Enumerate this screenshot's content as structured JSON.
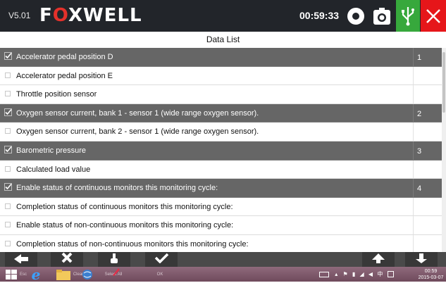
{
  "header": {
    "version": "V5.01",
    "brand_prefix": "F",
    "brand_o": "O",
    "brand_suffix": "XWELL",
    "time": "00:59:33",
    "colors": {
      "bar": "#22252a",
      "usb": "#37a83c",
      "close": "#e6161a",
      "logo_accent": "#e4312b"
    }
  },
  "page_title": "Data List",
  "rows": [
    {
      "label": "Accelerator pedal position D",
      "checked": true,
      "index": "1"
    },
    {
      "label": "Accelerator pedal position E",
      "checked": false,
      "index": ""
    },
    {
      "label": "Throttle position sensor",
      "checked": false,
      "index": ""
    },
    {
      "label": "Oxygen sensor current, bank 1 - sensor 1 (wide range oxygen sensor).",
      "checked": true,
      "index": "2"
    },
    {
      "label": "Oxygen sensor current, bank 2 - sensor 1 (wide range oxygen sensor).",
      "checked": false,
      "index": ""
    },
    {
      "label": "Barometric pressure",
      "checked": true,
      "index": "3"
    },
    {
      "label": "Calculated load value",
      "checked": false,
      "index": ""
    },
    {
      "label": "Enable status of continuous monitors this monitoring cycle:",
      "checked": true,
      "index": "4"
    },
    {
      "label": "Completion status of continuous monitors this monitoring cycle:",
      "checked": false,
      "index": ""
    },
    {
      "label": "Enable status of non-continuous monitors this monitoring cycle:",
      "checked": false,
      "index": ""
    },
    {
      "label": "Completion status of non-continuous monitors this monitoring cycle:",
      "checked": false,
      "index": ""
    }
  ],
  "toolbar": {
    "esc_label": "Esc",
    "clear_all_label": "Clear All",
    "select_all_label": "Select All",
    "ok_label": "OK"
  },
  "taskbar": {
    "ime": "中",
    "time": "00:59",
    "date": "2015-03-07"
  }
}
